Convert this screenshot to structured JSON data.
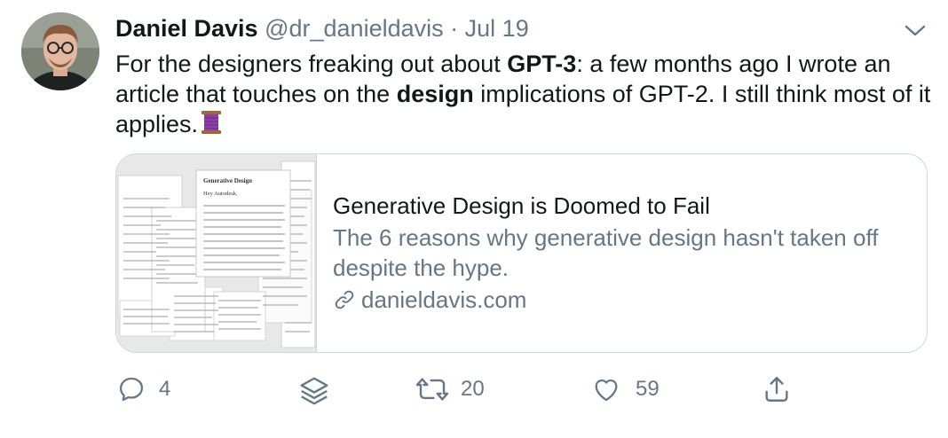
{
  "tweet": {
    "author_name": "Daniel Davis",
    "handle": "@dr_danieldavis",
    "separator": "·",
    "date": "Jul 19",
    "text_1": "For the designers freaking out about ",
    "text_bold_1": "GPT-3",
    "text_2": ": a few months ago I wrote an article that touches on the ",
    "text_bold_2": "design",
    "text_3": " implications of GPT-2. I still think most of it applies."
  },
  "card": {
    "title": "Generative Design is Doomed to Fail",
    "description": "The 6 reasons why generative design hasn't taken off despite the hype.",
    "domain": "danieldavis.com",
    "thumb_heading": "Generative Design",
    "thumb_greeting": "Hey Autodesk,",
    "thumb_body": "How much do you think the future of a platform could be if the developers got good at it and they developed something better? And what do you think about how you would manage that? What would you do if you decided to make that a very important decision? We would be writing software, and you would"
  },
  "actions": {
    "reply_count": "4",
    "retweet_count": "20",
    "like_count": "59"
  },
  "icons": [
    "chevron-down-icon",
    "spool-emoji-icon",
    "link-icon",
    "reply-icon",
    "layers-icon",
    "retweet-icon",
    "heart-icon",
    "share-icon"
  ],
  "colors": {
    "text": "#14171a",
    "secondary": "#657786",
    "border": "#ccd6dd"
  }
}
